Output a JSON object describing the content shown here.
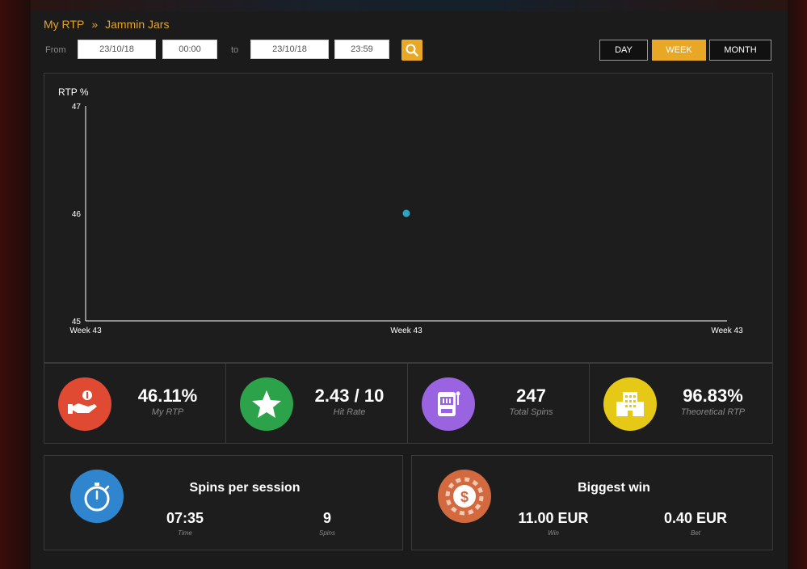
{
  "breadcrumb": {
    "root": "My RTP",
    "separator": "»",
    "current": "Jammin Jars"
  },
  "filters": {
    "from_label": "From",
    "from_date": "23/10/18",
    "from_time": "00:00",
    "to_label": "to",
    "to_date": "23/10/18",
    "to_time": "23:59",
    "periods": [
      {
        "label": "DAY",
        "active": false
      },
      {
        "label": "WEEK",
        "active": true
      },
      {
        "label": "MONTH",
        "active": false
      }
    ]
  },
  "chart_data": {
    "type": "scatter",
    "ylabel": "RTP %",
    "ylim": [
      45,
      47
    ],
    "yticks": [
      "45",
      "46",
      "47"
    ],
    "xticks": [
      "Week 43",
      "Week 43",
      "Week 43"
    ],
    "points": [
      {
        "x": "Week 43",
        "y": 46
      }
    ],
    "point_color": "#2aa6c4",
    "grid": false
  },
  "stats": [
    {
      "value": "46.11%",
      "caption": "My RTP",
      "icon": "hand-coin-icon",
      "color": "#e04a33"
    },
    {
      "value": "2.43 / 10",
      "caption": "Hit Rate",
      "icon": "star-icon",
      "color": "#2ca24a"
    },
    {
      "value": "247",
      "caption": "Total Spins",
      "icon": "slot-machine-icon",
      "color": "#9a63e0"
    },
    {
      "value": "96.83%",
      "caption": "Theoretical RTP",
      "icon": "building-icon",
      "color": "#e6c817"
    }
  ],
  "spins_session": {
    "title": "Spins per session",
    "icon": "stopwatch-icon",
    "color": "#2f86cf",
    "time_value": "07:35",
    "time_label": "Time",
    "spins_value": "9",
    "spins_label": "Spins"
  },
  "biggest_win": {
    "title": "Biggest win",
    "icon": "casino-chip-icon",
    "color": "#d2693f",
    "win_value": "11.00 EUR",
    "win_label": "Win",
    "bet_value": "0.40 EUR",
    "bet_label": "Bet"
  }
}
